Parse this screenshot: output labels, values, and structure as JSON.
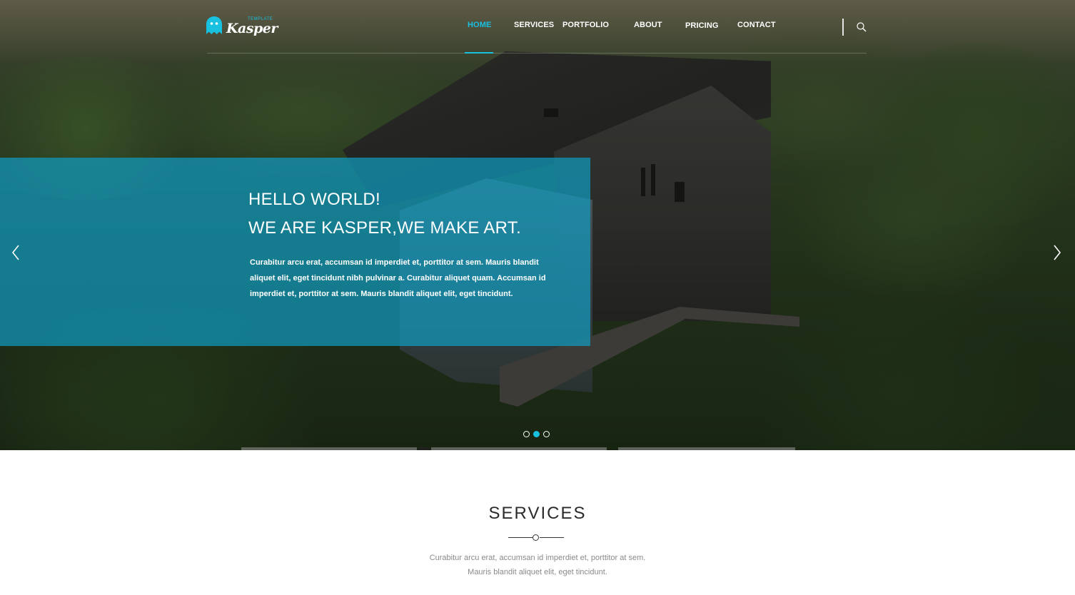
{
  "brand": {
    "logo_text": "Kasper",
    "logo_subtext": "TEMPLATE",
    "accent_color": "#19c1e0"
  },
  "nav": {
    "items": [
      {
        "label": "HOME",
        "active": true
      },
      {
        "label": "SERVICES",
        "active": false
      },
      {
        "label": "PORTFOLIO",
        "active": false
      },
      {
        "label": "ABOUT",
        "active": false
      },
      {
        "label": "PRICING",
        "active": false
      },
      {
        "label": "CONTACT",
        "active": false
      }
    ],
    "search_icon": "search-icon"
  },
  "hero": {
    "heading_line1": "HELLO WORLD!",
    "heading_line2": "WE ARE KASPER,WE MAKE ART.",
    "text": "Curabitur arcu erat, accumsan id imperdiet et, porttitor at sem. Mauris blandit aliquet elit, eget tincidunt nibh pulvinar a. Curabitur aliquet quam. Accumsan id imperdiet et, porttitor at sem. Mauris blandit aliquet elit, eget tincidunt.",
    "caption_color": "#109abe",
    "prev_icon": "chevron-left-icon",
    "next_icon": "chevron-right-icon",
    "slides": 3,
    "active_slide": 2
  },
  "services": {
    "title": "SERVICES",
    "description": "Curabitur arcu erat, accumsan id imperdiet et, porttitor at sem. Mauris blandit aliquet elit, eget tincidunt."
  }
}
